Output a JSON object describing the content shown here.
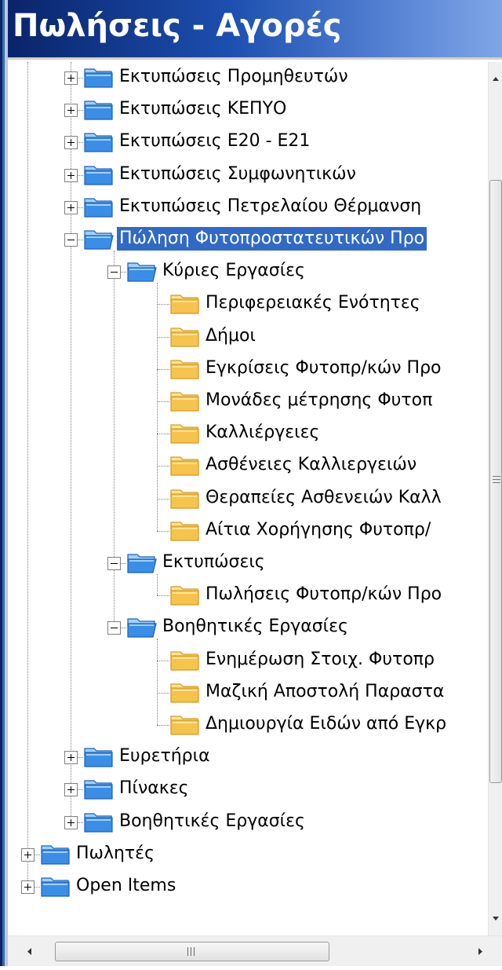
{
  "window": {
    "title": "Πωλήσεις - Αγορές"
  },
  "colors": {
    "title_gradient_start": "#0a246a",
    "title_gradient_end": "#7fa6e6",
    "selection": "#316ac5",
    "folder": "#3a8ee8",
    "folder_yellow": "#f6c34c"
  },
  "tree": {
    "items": [
      {
        "label": "Εκτυπώσεις Προμηθευτών",
        "level": 1,
        "state": "collapsed",
        "folder": "blue-folder-icon"
      },
      {
        "label": "Εκτυπώσεις ΚΕΠΥΟ",
        "level": 1,
        "state": "collapsed",
        "folder": "blue-folder-icon"
      },
      {
        "label": "Εκτυπώσεις Ε20 - Ε21",
        "level": 1,
        "state": "collapsed",
        "folder": "blue-folder-icon"
      },
      {
        "label": "Εκτυπώσεις Συμφωνητικών",
        "level": 1,
        "state": "collapsed",
        "folder": "blue-folder-icon"
      },
      {
        "label": "Εκτυπώσεις Πετρελαίου Θέρμανση",
        "level": 1,
        "state": "collapsed",
        "folder": "blue-folder-icon"
      },
      {
        "label": "Πώληση Φυτοπροστατευτικών Προ",
        "level": 1,
        "state": "expanded",
        "folder": "blue-open-folder-icon",
        "selected": true
      },
      {
        "label": "Κύριες Εργασίες",
        "level": 2,
        "state": "expanded",
        "folder": "blue-open-folder-icon"
      },
      {
        "label": "Περιφερειακές Ενότητες",
        "level": 3,
        "state": "leaf",
        "folder": "yellow-folder-icon"
      },
      {
        "label": "Δήμοι",
        "level": 3,
        "state": "leaf",
        "folder": "yellow-folder-icon"
      },
      {
        "label": "Εγκρίσεις Φυτοπρ/κών Προ",
        "level": 3,
        "state": "leaf",
        "folder": "yellow-folder-icon"
      },
      {
        "label": "Μονάδες μέτρησης Φυτοπ",
        "level": 3,
        "state": "leaf",
        "folder": "yellow-folder-icon"
      },
      {
        "label": "Καλλιέργειες",
        "level": 3,
        "state": "leaf",
        "folder": "yellow-folder-icon"
      },
      {
        "label": "Ασθένειες Καλλιεργειών",
        "level": 3,
        "state": "leaf",
        "folder": "yellow-folder-icon"
      },
      {
        "label": "Θεραπείες Ασθενειών Καλλ",
        "level": 3,
        "state": "leaf",
        "folder": "yellow-folder-icon"
      },
      {
        "label": "Αίτια Χορήγησης Φυτοπρ/",
        "level": 3,
        "state": "leaf",
        "folder": "yellow-folder-icon"
      },
      {
        "label": "Εκτυπώσεις",
        "level": 2,
        "state": "expanded",
        "folder": "blue-open-folder-icon"
      },
      {
        "label": "Πωλήσεις Φυτοπρ/κών Προ",
        "level": 3,
        "state": "leaf",
        "folder": "yellow-folder-icon"
      },
      {
        "label": "Βοηθητικές Εργασίες",
        "level": 2,
        "state": "expanded",
        "folder": "blue-open-folder-icon"
      },
      {
        "label": "Ενημέρωση Στοιχ. Φυτοπρ",
        "level": 3,
        "state": "leaf",
        "folder": "yellow-folder-icon"
      },
      {
        "label": "Μαζική Αποστολή Παραστα",
        "level": 3,
        "state": "leaf",
        "folder": "yellow-folder-icon"
      },
      {
        "label": "Δημιουργία Ειδών από Εγκρ",
        "level": 3,
        "state": "leaf",
        "folder": "yellow-folder-icon"
      },
      {
        "label": "Ευρετήρια",
        "level": 1,
        "state": "collapsed",
        "folder": "blue-folder-icon"
      },
      {
        "label": "Πίνακες",
        "level": 1,
        "state": "collapsed",
        "folder": "blue-folder-icon"
      },
      {
        "label": "Βοηθητικές Εργασίες",
        "level": 1,
        "state": "collapsed",
        "folder": "blue-folder-icon"
      },
      {
        "label": "Πωλητές",
        "level": 0,
        "state": "collapsed",
        "folder": "blue-folder-icon"
      },
      {
        "label": "Open Items",
        "level": 0,
        "state": "collapsed",
        "folder": "blue-folder-icon"
      }
    ]
  },
  "scrollbars": {
    "vertical": {
      "up_icon": "scroll-up-arrow-icon",
      "down_icon": "scroll-down-arrow-icon",
      "grip_icon": "grip-icon"
    },
    "horizontal": {
      "left_icon": "scroll-left-arrow-icon",
      "right_icon": "scroll-right-arrow-icon",
      "grip_label": "III"
    }
  }
}
